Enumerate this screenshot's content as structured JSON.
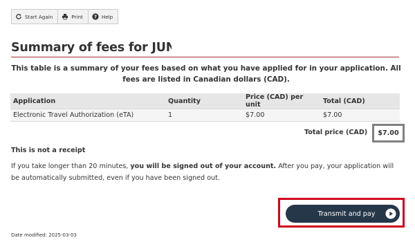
{
  "toolbar": {
    "start_again": "Start Again",
    "print": "Print",
    "help": "Help"
  },
  "page_title": "Summary of fees for JUNG G",
  "caption": "This table is a summary of your fees based on what you have applied for in your application. All fees are listed in Canadian dollars (CAD).",
  "table": {
    "headers": [
      "Application",
      "Quantity",
      "Price (CAD) per unit",
      "Total (CAD)"
    ],
    "rows": [
      [
        "Electronic Travel Authorization (eTA)",
        "1",
        "$7.00",
        "$7.00"
      ]
    ]
  },
  "total": {
    "label": "Total price (CAD)",
    "value": "$7.00"
  },
  "receipt_notice": "This is not a receipt",
  "warning": {
    "part1": "If you take longer than 20 minutes, ",
    "bold": "you will be signed out of your account.",
    "part2": " After you pay, your application will be automatically submitted, even if you have been signed out."
  },
  "pay_button": "Transmit and pay",
  "date_modified": "Date modified: 2025-03-03",
  "colors": {
    "accent_rule": "#a3302e",
    "button_bg": "#26374a",
    "highlight": "#d0021b"
  }
}
